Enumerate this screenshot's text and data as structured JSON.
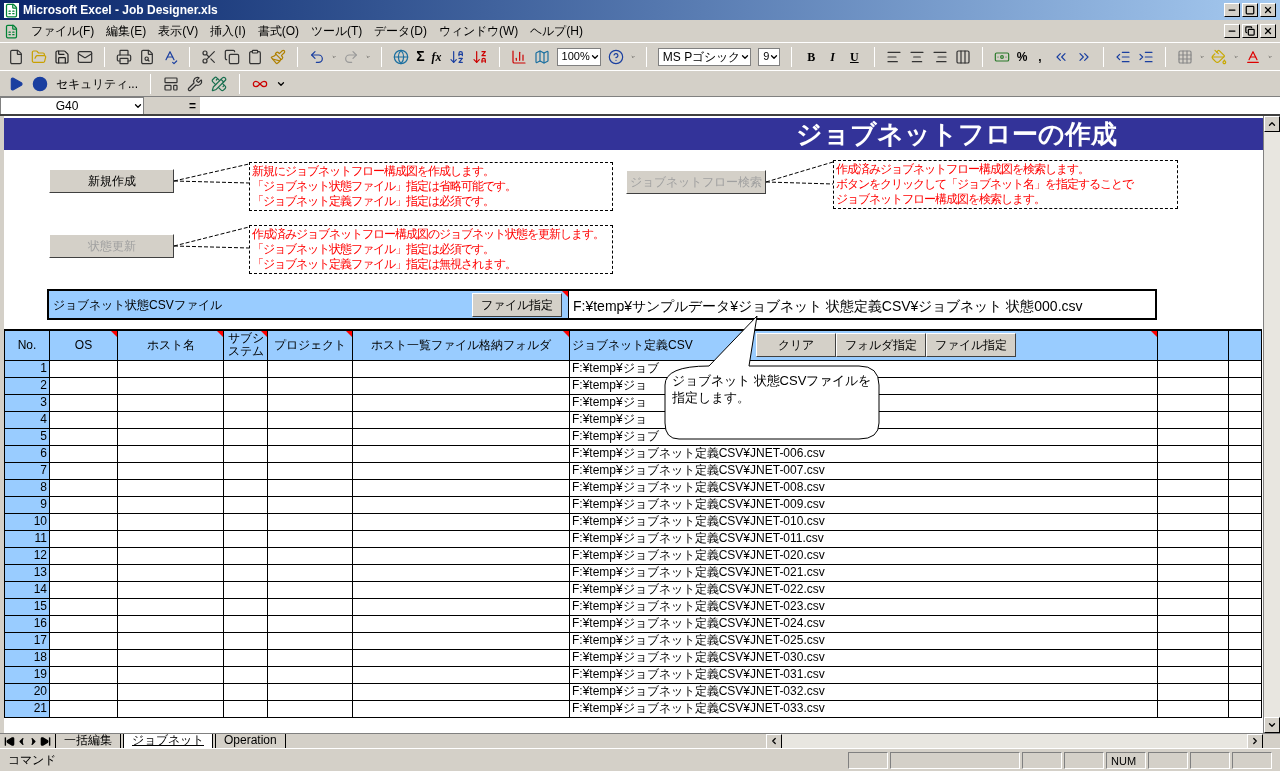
{
  "window": {
    "title": "Microsoft Excel - Job Designer.xls"
  },
  "menu": [
    "ファイル(F)",
    "編集(E)",
    "表示(V)",
    "挿入(I)",
    "書式(O)",
    "ツール(T)",
    "データ(D)",
    "ウィンドウ(W)",
    "ヘルプ(H)"
  ],
  "toolbar": {
    "sigma": "Σ",
    "fx": "fx",
    "zoom": "100%",
    "font": "MS Pゴシック",
    "size": "9",
    "bold": "B",
    "italic": "I",
    "underline": "U",
    "percent": "%",
    "comma": ","
  },
  "toolbar2": {
    "security": "セキュリティ..."
  },
  "formula_bar": {
    "name_box": "G40",
    "equals": "="
  },
  "sheet": {
    "banner": "ジョブネットフローの作成",
    "shapes": [
      {
        "label": "新規作成",
        "disabled": false,
        "note": [
          "新規にジョブネットフロー構成図を作成します。",
          "「ジョブネット状態ファイル」指定は省略可能です。",
          "「ジョブネット定義ファイル」指定は必須です。"
        ]
      },
      {
        "label": "状態更新",
        "disabled": true,
        "note": [
          "作成済みジョブネットフロー構成図のジョブネット状態を更新します。",
          "「ジョブネット状態ファイル」指定は必須です。",
          "「ジョブネット定義ファイル」指定は無視されます。"
        ]
      },
      {
        "label": "ジョブネットフロー検索",
        "disabled": true,
        "note": [
          "作成済みジョブネットフロー構成図を検索します。",
          "ボタンをクリックして「ジョブネット名」を指定することで",
          "ジョブネットフロー構成図を検索します。"
        ]
      }
    ],
    "status_file": {
      "label": "ジョブネット状態CSVファイル",
      "button": "ファイル指定",
      "path": "F:¥temp¥サンプルデータ¥ジョブネット 状態定義CSV¥ジョブネット 状態000.csv"
    },
    "table": {
      "columns": [
        "No.",
        "OS",
        "ホスト名",
        "サブシステム",
        "プロジェクト",
        "ホスト一覧ファイル格納フォルダ",
        "ジョブネット定義CSV"
      ],
      "buttons": [
        "クリア",
        "フォルダ指定",
        "ファイル指定"
      ],
      "rows": [
        {
          "no": "1",
          "csv": "F:¥temp¥ジョブ"
        },
        {
          "no": "2",
          "csv": "F:¥temp¥ジョ"
        },
        {
          "no": "3",
          "csv": "F:¥temp¥ジョ"
        },
        {
          "no": "4",
          "csv": "F:¥temp¥ジョ"
        },
        {
          "no": "5",
          "csv": "F:¥temp¥ジョブ"
        },
        {
          "no": "6",
          "csv": "F:¥temp¥ジョブネット定義CSV¥JNET-006.csv"
        },
        {
          "no": "7",
          "csv": "F:¥temp¥ジョブネット定義CSV¥JNET-007.csv"
        },
        {
          "no": "8",
          "csv": "F:¥temp¥ジョブネット定義CSV¥JNET-008.csv"
        },
        {
          "no": "9",
          "csv": "F:¥temp¥ジョブネット定義CSV¥JNET-009.csv"
        },
        {
          "no": "10",
          "csv": "F:¥temp¥ジョブネット定義CSV¥JNET-010.csv"
        },
        {
          "no": "11",
          "csv": "F:¥temp¥ジョブネット定義CSV¥JNET-011.csv"
        },
        {
          "no": "12",
          "csv": "F:¥temp¥ジョブネット定義CSV¥JNET-020.csv"
        },
        {
          "no": "13",
          "csv": "F:¥temp¥ジョブネット定義CSV¥JNET-021.csv"
        },
        {
          "no": "14",
          "csv": "F:¥temp¥ジョブネット定義CSV¥JNET-022.csv"
        },
        {
          "no": "15",
          "csv": "F:¥temp¥ジョブネット定義CSV¥JNET-023.csv"
        },
        {
          "no": "16",
          "csv": "F:¥temp¥ジョブネット定義CSV¥JNET-024.csv"
        },
        {
          "no": "17",
          "csv": "F:¥temp¥ジョブネット定義CSV¥JNET-025.csv"
        },
        {
          "no": "18",
          "csv": "F:¥temp¥ジョブネット定義CSV¥JNET-030.csv"
        },
        {
          "no": "19",
          "csv": "F:¥temp¥ジョブネット定義CSV¥JNET-031.csv"
        },
        {
          "no": "20",
          "csv": "F:¥temp¥ジョブネット定義CSV¥JNET-032.csv"
        },
        {
          "no": "21",
          "csv": "F:¥temp¥ジョブネット定義CSV¥JNET-033.csv"
        }
      ]
    },
    "callout": [
      "ジョブネット 状態CSVファイルを",
      "指定します。"
    ]
  },
  "sheet_tabs": [
    {
      "label": "一括編集",
      "selected": false
    },
    {
      "label": "ジョブネット",
      "selected": true
    },
    {
      "label": "Operation",
      "selected": false
    }
  ],
  "status_bar": {
    "text": "コマンド",
    "num": "NUM"
  }
}
